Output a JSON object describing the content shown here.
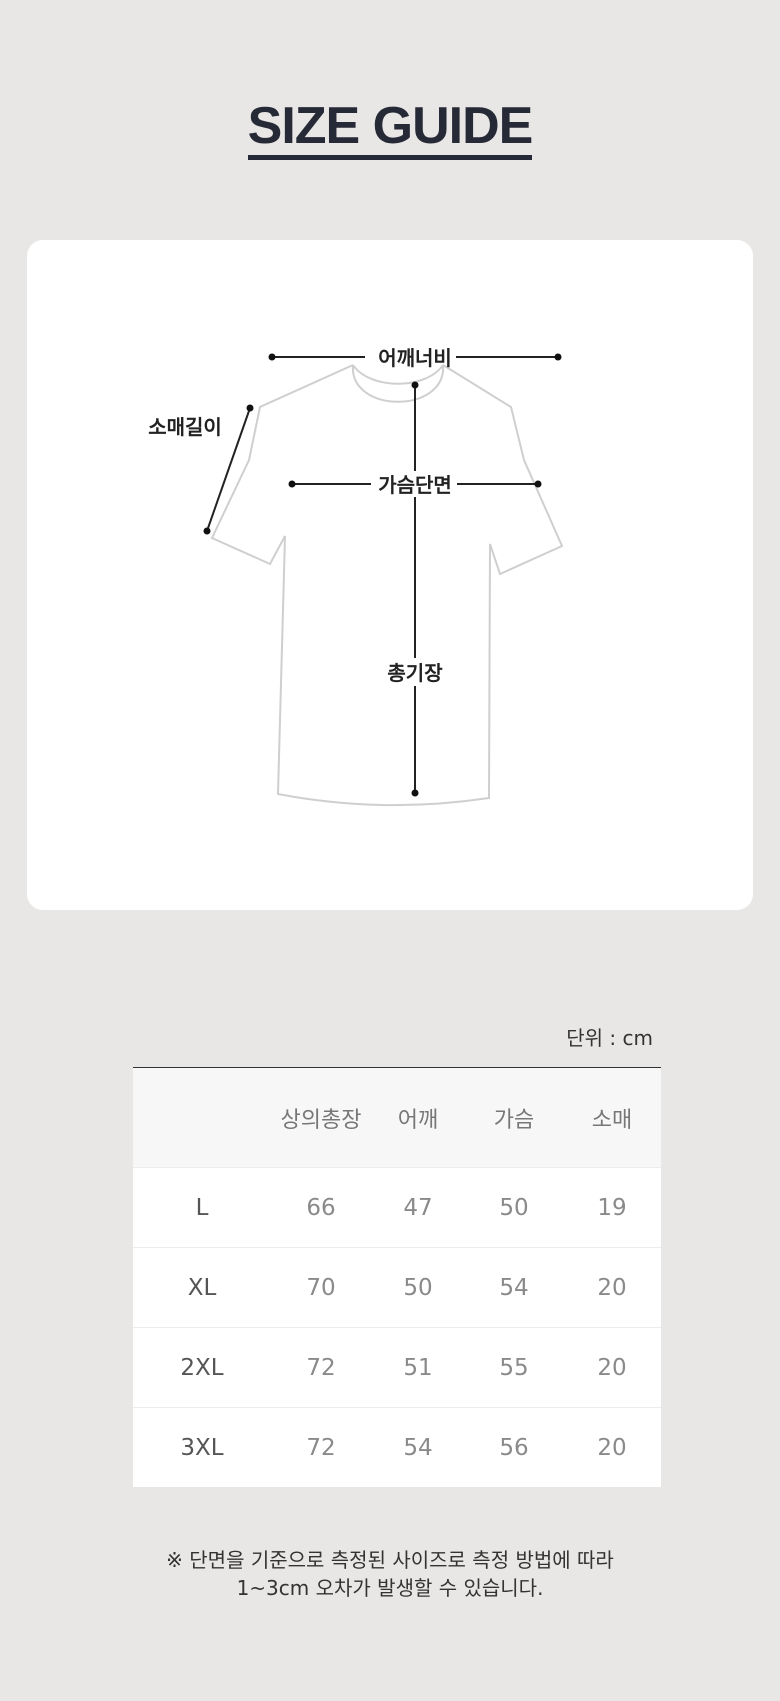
{
  "title": "SIZE GUIDE",
  "diagram": {
    "shoulder_label": "어깨너비",
    "sleeve_label": "소매길이",
    "chest_label": "가슴단면",
    "length_label": "총기장"
  },
  "unit_label": "단위 : cm",
  "table": {
    "headers": [
      "",
      "상의총장",
      "어깨",
      "가슴",
      "소매"
    ],
    "rows": [
      {
        "size": "L",
        "values": [
          "66",
          "47",
          "50",
          "19"
        ]
      },
      {
        "size": "XL",
        "values": [
          "70",
          "50",
          "54",
          "20"
        ]
      },
      {
        "size": "2XL",
        "values": [
          "72",
          "51",
          "55",
          "20"
        ]
      },
      {
        "size": "3XL",
        "values": [
          "72",
          "54",
          "56",
          "20"
        ]
      }
    ]
  },
  "note": {
    "line1": "※ 단면을 기준으로 측정된 사이즈로 측정 방법에 따라",
    "line2": "1~3cm 오차가 발생할 수 있습니다."
  }
}
